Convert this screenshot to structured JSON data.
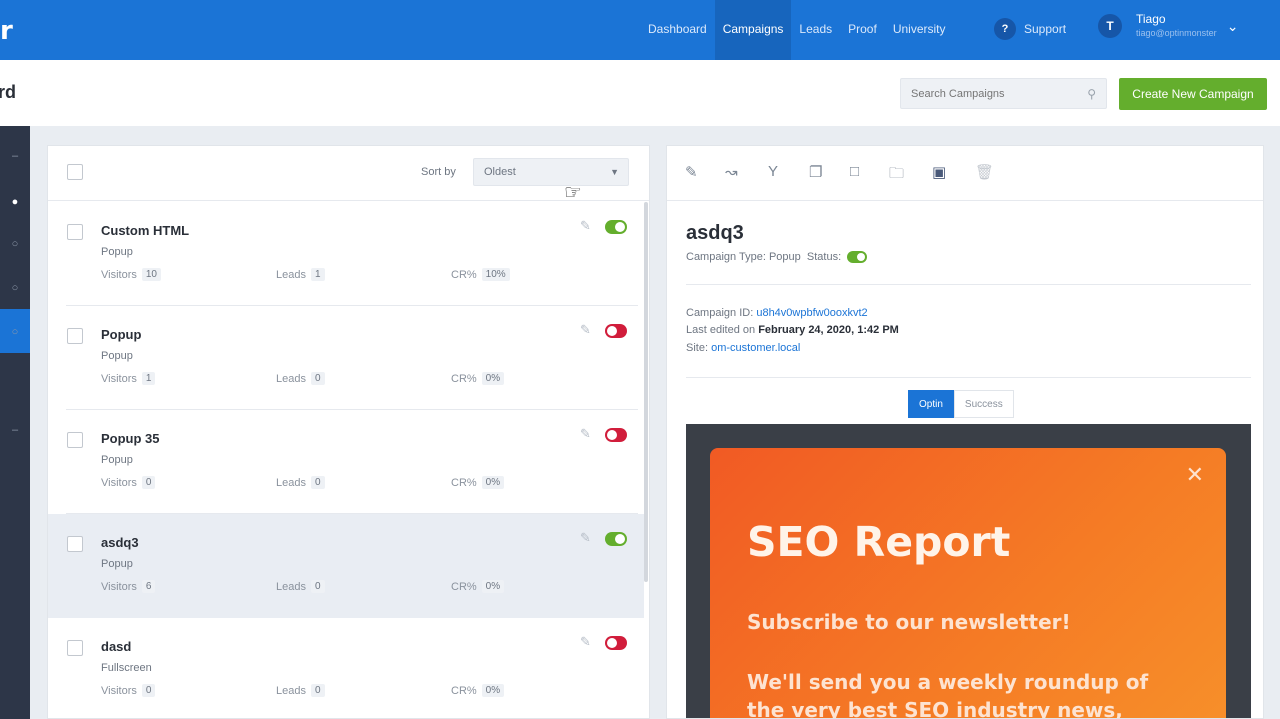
{
  "app": {
    "logo_text": "r",
    "page_title": "rd"
  },
  "nav": {
    "items": [
      {
        "label": "Dashboard"
      },
      {
        "label": "Campaigns"
      },
      {
        "label": "Leads"
      },
      {
        "label": "Proof"
      },
      {
        "label": "University"
      }
    ],
    "active": "Campaigns",
    "support_label": "Support",
    "support_icon": "?",
    "user_initial": "T",
    "user_name": "Tiago",
    "user_email": "tiago@optinmonster"
  },
  "header": {
    "search_placeholder": "Search Campaigns",
    "create_button": "Create New Campaign"
  },
  "list": {
    "sort_label": "Sort by",
    "sort_value": "Oldest",
    "stat_labels": {
      "visitors": "Visitors",
      "leads": "Leads",
      "cr": "CR%"
    },
    "rows": [
      {
        "name": "Custom HTML",
        "type": "Popup",
        "visitors": "10",
        "leads": "1",
        "cr": "10%",
        "status": "on"
      },
      {
        "name": "Popup",
        "type": "Popup",
        "visitors": "1",
        "leads": "0",
        "cr": "0%",
        "status": "off"
      },
      {
        "name": "Popup 35",
        "type": "Popup",
        "visitors": "0",
        "leads": "0",
        "cr": "0%",
        "status": "off"
      },
      {
        "name": "asdq3",
        "type": "Popup",
        "visitors": "6",
        "leads": "0",
        "cr": "0%",
        "status": "on"
      },
      {
        "name": "dasd",
        "type": "Fullscreen",
        "visitors": "0",
        "leads": "0",
        "cr": "0%",
        "status": "off"
      }
    ]
  },
  "detail": {
    "title": "asdq3",
    "campaign_type_label": "Campaign Type:",
    "campaign_type": "Popup",
    "status_label": "Status:",
    "campaign_id_label": "Campaign ID:",
    "campaign_id": "u8h4v0wpbfw0ooxkvt2",
    "last_edited_label": "Last edited on",
    "last_edited": "February 24, 2020, 1:42 PM",
    "site_label": "Site:",
    "site": "om-customer.local",
    "tabs": [
      "Optin",
      "Success"
    ],
    "active_tab": "Optin",
    "toolbar_icons": [
      "edit-icon",
      "analytics-icon",
      "split-test-icon",
      "duplicate-icon",
      "archive-icon",
      "folder-icon",
      "save-icon",
      "trash-icon"
    ]
  },
  "preview": {
    "title": "SEO Report",
    "subtitle": "Subscribe to our newsletter!",
    "body": "We'll send you a weekly roundup of the very best SEO industry news, latest",
    "close_glyph": "✕"
  },
  "colors": {
    "nav_blue": "#1b74d6",
    "create_green": "#64ae2d",
    "toggle_on": "#64ae2d",
    "toggle_off": "#d11d3b",
    "popup_orange": "#f15a24"
  }
}
